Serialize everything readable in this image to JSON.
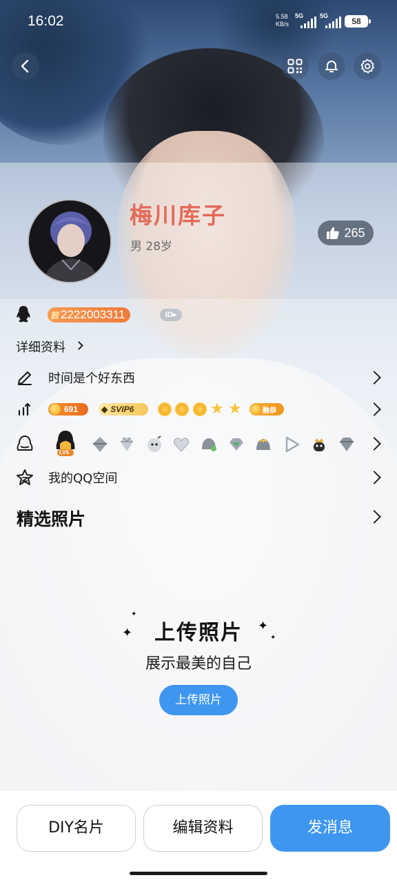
{
  "status_bar": {
    "time": "16:02",
    "net_speed_value": "5.58",
    "net_speed_unit": "KB/s",
    "sim1": "5G",
    "sim2": "5G",
    "battery": "58"
  },
  "profile": {
    "nickname": "梅川库子",
    "gender_age": "男  28岁",
    "likes": "265",
    "qq_number": "2222003311",
    "qq_crown_text": "靓",
    "id_tag": "ID"
  },
  "rows": {
    "detail_label": "详细资料",
    "signature": "时间是个好东西",
    "level_coin": "691",
    "svip": "SVIP6",
    "level_tag": "融恭",
    "badge_level": "LV6",
    "qzone": "我的QQ空间",
    "photos_section": "精选照片"
  },
  "upload": {
    "title": "上传照片",
    "subtitle": "展示最美的自己",
    "button": "上传照片"
  },
  "bottom_bar": {
    "diy_card": "DIY名片",
    "edit_profile": "编辑资料",
    "send_message": "发消息"
  },
  "colors": {
    "accent_blue": "#3f96ef",
    "nickname_red": "#e46a5a",
    "qq_number_orange": "#ef7b3a"
  }
}
